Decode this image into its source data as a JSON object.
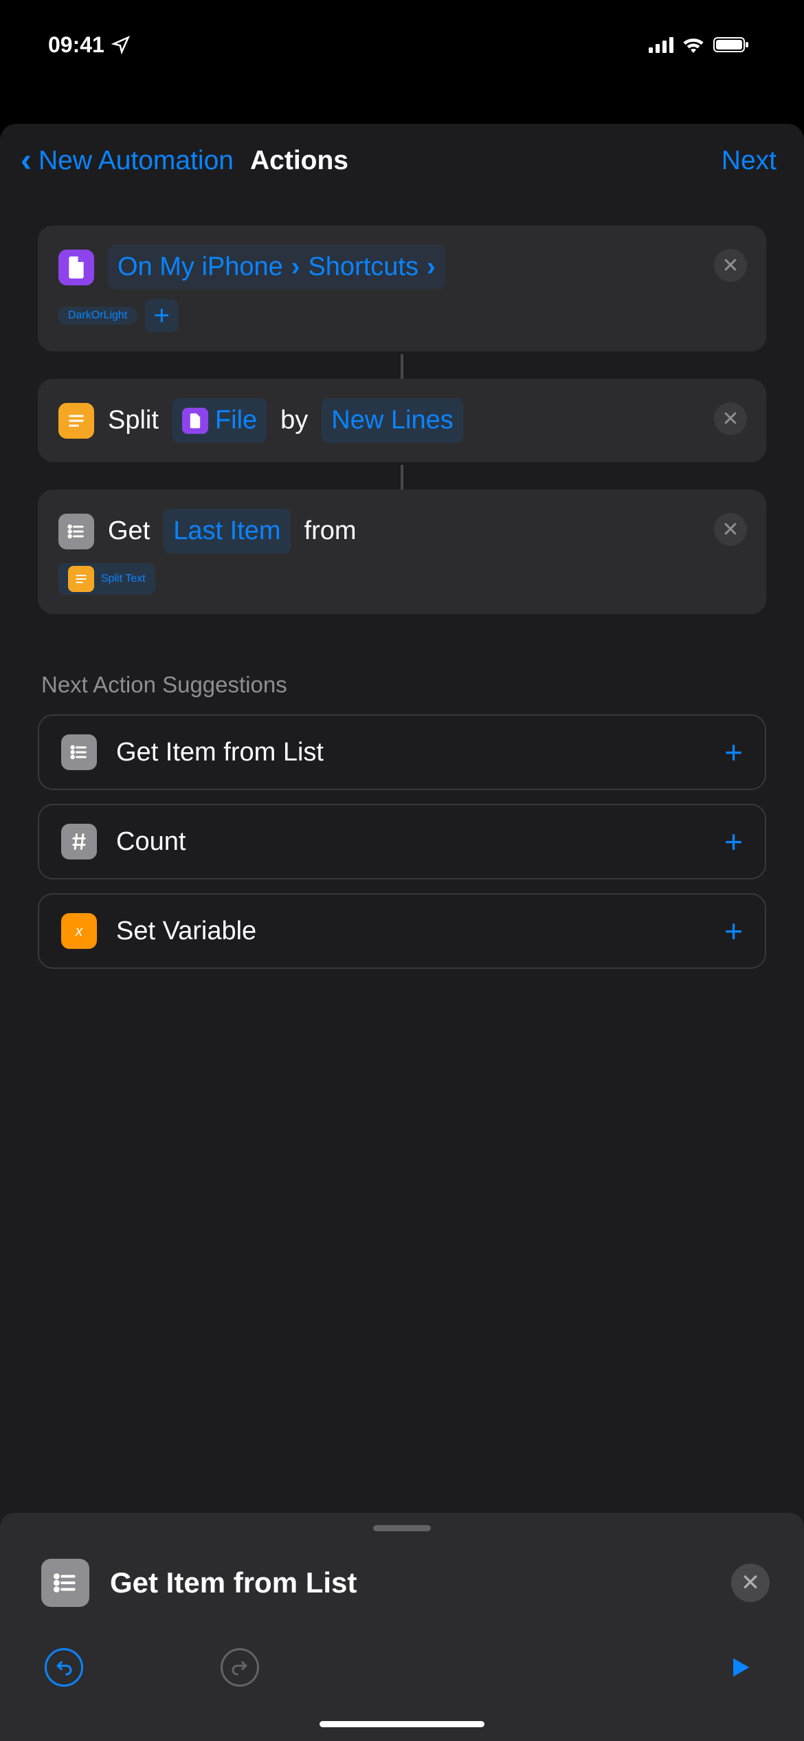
{
  "status": {
    "time": "09:41"
  },
  "nav": {
    "back": "New Automation",
    "title": "Actions",
    "next": "Next"
  },
  "actions": {
    "file": {
      "path1": "On My iPhone",
      "path2": "Shortcuts",
      "filename": "DarkOrLight"
    },
    "split": {
      "verb": "Split",
      "target": "File",
      "by": "by",
      "mode": "New Lines"
    },
    "get": {
      "verb": "Get",
      "which": "Last Item",
      "from": "from",
      "source": "Split Text"
    }
  },
  "suggestions": {
    "header": "Next Action Suggestions",
    "items": [
      {
        "label": "Get Item from List"
      },
      {
        "label": "Count"
      },
      {
        "label": "Set Variable"
      }
    ]
  },
  "bottom": {
    "title": "Get Item from List"
  }
}
